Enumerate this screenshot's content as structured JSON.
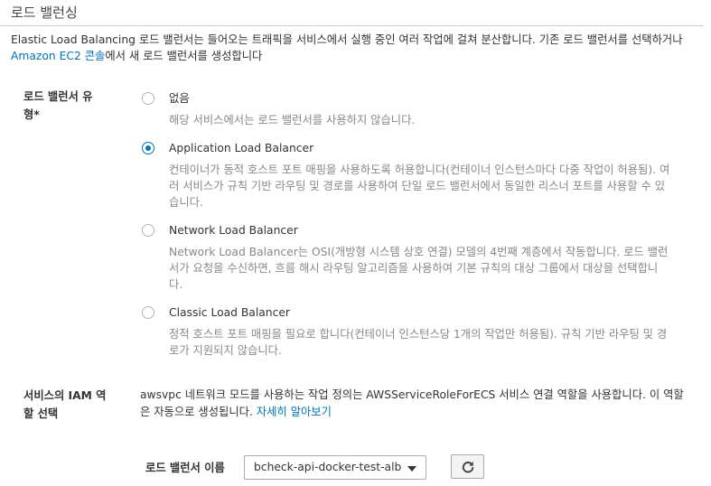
{
  "section": {
    "title": "로드 밸런싱",
    "intro_text": "Elastic Load Balancing 로드 밸런서는 들어오는 트래픽을 서비스에서 실행 중인 여러 작업에 걸쳐 분산합니다. 기존 로드 밸런서를 선택하거나 ",
    "intro_link": "Amazon EC2 콘솔",
    "intro_suffix": "에서 새 로드 밸런서를 생성합니다"
  },
  "lb_type": {
    "label_line1": "로드 밸런서 유",
    "label_line2": "형*",
    "selected": "Application Load Balancer",
    "options": [
      {
        "label": "없음",
        "description": "해당 서비스에서는 로드 밸런서를 사용하지 않습니다."
      },
      {
        "label": "Application Load Balancer",
        "description": "컨테이너가 동적 호스트 포트 매핑을 사용하도록 허용합니다(컨테이너 인스턴스마다 다중 작업이 허용됨). 여러 서비스가 규칙 기반 라우팅 및 경로를 사용하여 단일 로드 밸런서에서 동일한 리스너 포트를 사용할 수 있습니다."
      },
      {
        "label": "Network Load Balancer",
        "description": "Network Load Balancer는 OSI(개방형 시스템 상호 연결) 모델의 4번째 계층에서 작동합니다. 로드 밸런서가 요청을 수신하면, 흐름 해시 라우팅 알고리즘을 사용하여 기본 규칙의 대상 그룹에서 대상을 선택합니다."
      },
      {
        "label": "Classic Load Balancer",
        "description": "정적 호스트 포트 매핑을 필요로 합니다(컨테이너 인스턴스당 1개의 작업만 허용됨). 규칙 기반 라우팅 및 경로가 지원되지 않습니다."
      }
    ]
  },
  "iam": {
    "label_line1": "서비스의 IAM 역",
    "label_line2": "할 선택",
    "description": "awsvpc 네트워크 모드를 사용하는 작업 정의는 AWSServiceRoleForECS 서비스 연결 역할을 사용합니다. 이 역할은 자동으로 생성됩니다. ",
    "learn_more": "자세히 알아보기"
  },
  "lb_name": {
    "label": "로드 밸런서 이름",
    "value": "bcheck-api-docker-test-alb",
    "refresh_icon": "refresh-icon"
  },
  "colors": {
    "link": "#0073bb",
    "radio_selected": "#0073bb",
    "muted_text": "#888888"
  }
}
